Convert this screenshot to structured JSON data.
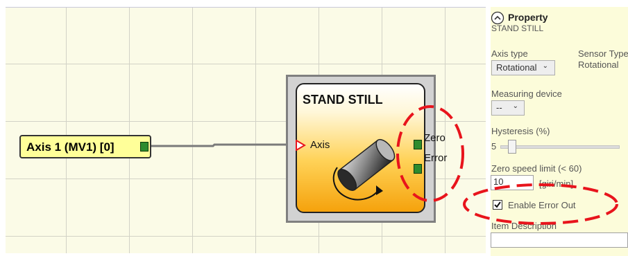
{
  "canvas": {
    "input_block": {
      "label": "Axis 1 (MV1) [0]"
    },
    "function_block": {
      "title": "STAND STILL",
      "input_label": "Axis",
      "outputs": [
        "Zero",
        "Error"
      ]
    }
  },
  "panel": {
    "title": "Property",
    "subtitle": "STAND STILL",
    "axis_type": {
      "label": "Axis type",
      "value": "Rotational"
    },
    "sensor_type": {
      "label": "Sensor Type",
      "value": "Rotational"
    },
    "measuring_device": {
      "label": "Measuring device",
      "value": "--"
    },
    "hysteresis": {
      "label": "Hysteresis (%)",
      "value": "5",
      "slider_fraction": 0.1
    },
    "zero_speed": {
      "label": "Zero speed limit  (< 60)",
      "value": "10",
      "unit": "[giri/min]"
    },
    "enable_error_out": {
      "label": "Enable Error Out",
      "checked": true
    },
    "item_description": {
      "label": "Item Description",
      "value": ""
    }
  },
  "annotations": {
    "highlight_color": "#e8141c"
  },
  "colors": {
    "port_green": "#2e8b2e",
    "input_marker": "#e8141c",
    "block_orange": "#f5a20c"
  }
}
